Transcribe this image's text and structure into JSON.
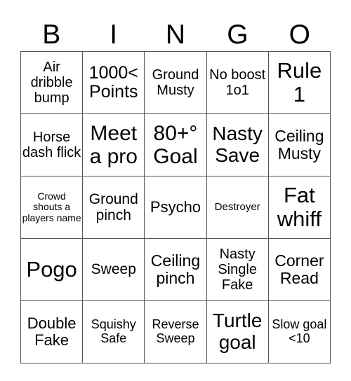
{
  "header": {
    "letters": [
      "B",
      "I",
      "N",
      "G",
      "O"
    ]
  },
  "rows": [
    [
      "Air dribble bump",
      "1000< Points",
      "Ground Musty",
      "No boost 1o1",
      "Rule 1"
    ],
    [
      "Horse dash flick",
      "Meet a pro",
      "80+° Goal",
      "Nasty Save",
      "Ceiling Musty"
    ],
    [
      "Crowd shouts a players name",
      "Ground pinch",
      "Psycho",
      "Destroyer",
      "Fat whiff"
    ],
    [
      "Pogo",
      "Sweep",
      "Ceiling pinch",
      "Nasty Single Fake",
      "Corner Read"
    ],
    [
      "Double Fake",
      "Squishy Safe",
      "Reverse Sweep",
      "Turtle goal",
      "Slow goal <10"
    ]
  ]
}
